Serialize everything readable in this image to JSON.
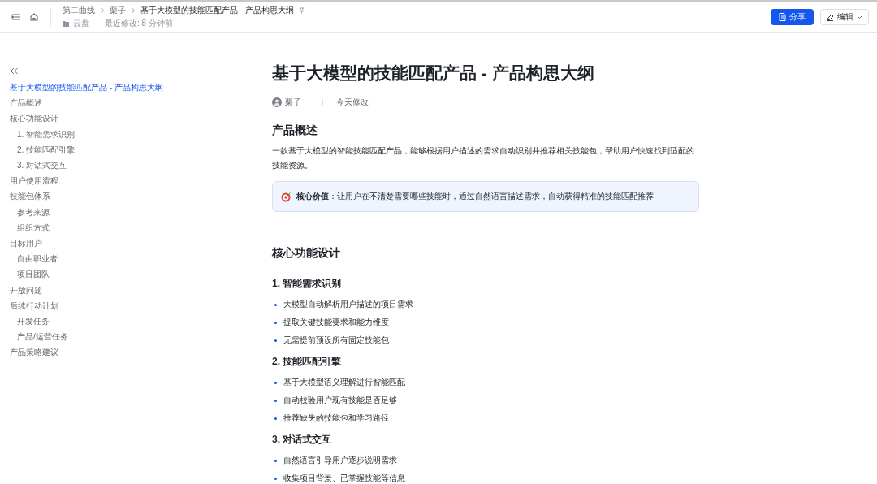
{
  "header": {
    "breadcrumbs": [
      "第二曲线",
      "栗子",
      "基于大模型的技能匹配产品 - 产品构思大纲"
    ],
    "location": "云盘",
    "modified": "最近修改: 8 分钟前",
    "share_button": "分享",
    "edit_button": "编辑"
  },
  "outline": {
    "items": [
      {
        "label": "基于大模型的技能匹配产品 - 产品构思大纲",
        "selected": true
      },
      {
        "label": "产品概述",
        "selected": false
      },
      {
        "label": "核心功能设计",
        "selected": false,
        "children": [
          {
            "label": "1. 智能需求识别",
            "selected": false
          },
          {
            "label": "2. 技能匹配引擎",
            "selected": false
          },
          {
            "label": "3. 对话式交互",
            "selected": false
          }
        ]
      },
      {
        "label": "用户使用流程",
        "selected": false
      },
      {
        "label": "技能包体系",
        "selected": false,
        "children": [
          {
            "label": "参考来源",
            "selected": false
          },
          {
            "label": "组织方式",
            "selected": false
          }
        ]
      },
      {
        "label": "目标用户",
        "selected": false,
        "children": [
          {
            "label": "自由职业者",
            "selected": false
          },
          {
            "label": "项目团队",
            "selected": false
          }
        ]
      },
      {
        "label": "开放问题",
        "selected": false
      },
      {
        "label": "后续行动计划",
        "selected": false,
        "children": [
          {
            "label": "开发任务",
            "selected": false
          },
          {
            "label": "产品/运营任务",
            "selected": false
          }
        ]
      },
      {
        "label": "产品策略建议",
        "selected": false
      }
    ]
  },
  "document": {
    "title": "基于大模型的技能匹配产品 - 产品构思大纲",
    "author": "栗子",
    "modified": "今天修改",
    "blocks": [
      {
        "kind": "h2",
        "text": "产品概述"
      },
      {
        "kind": "p",
        "text": "一款基于大模型的智能技能匹配产品，能够根据用户描述的需求自动识别并推荐相关技能包，帮助用户快速找到适配的技能资源。"
      },
      {
        "kind": "callout",
        "text": "**核心价值**：让用户在不清楚需要哪些技能时，通过自然语言描述需求，自动获得精准的技能匹配推荐"
      },
      {
        "kind": "divider"
      },
      {
        "kind": "h2",
        "text": "核心功能设计"
      },
      {
        "kind": "h3",
        "text": "1. 智能需求识别"
      },
      {
        "kind": "ul",
        "items": [
          "大模型自动解析用户描述的项目需求",
          "提取关键技能要求和能力维度",
          "无需提前预设所有固定技能包"
        ]
      },
      {
        "kind": "h3",
        "text": "2. 技能匹配引擎"
      },
      {
        "kind": "ul",
        "items": [
          "基于大模型语义理解进行智能匹配",
          "自动校验用户现有技能是否足够",
          "推荐缺失的技能包和学习路径"
        ]
      },
      {
        "kind": "h3",
        "text": "3. 对话式交互"
      },
      {
        "kind": "ul",
        "items": [
          "自然语言引导用户逐步说明需求",
          "收集项目背景、已掌握技能等信息"
        ]
      }
    ]
  }
}
